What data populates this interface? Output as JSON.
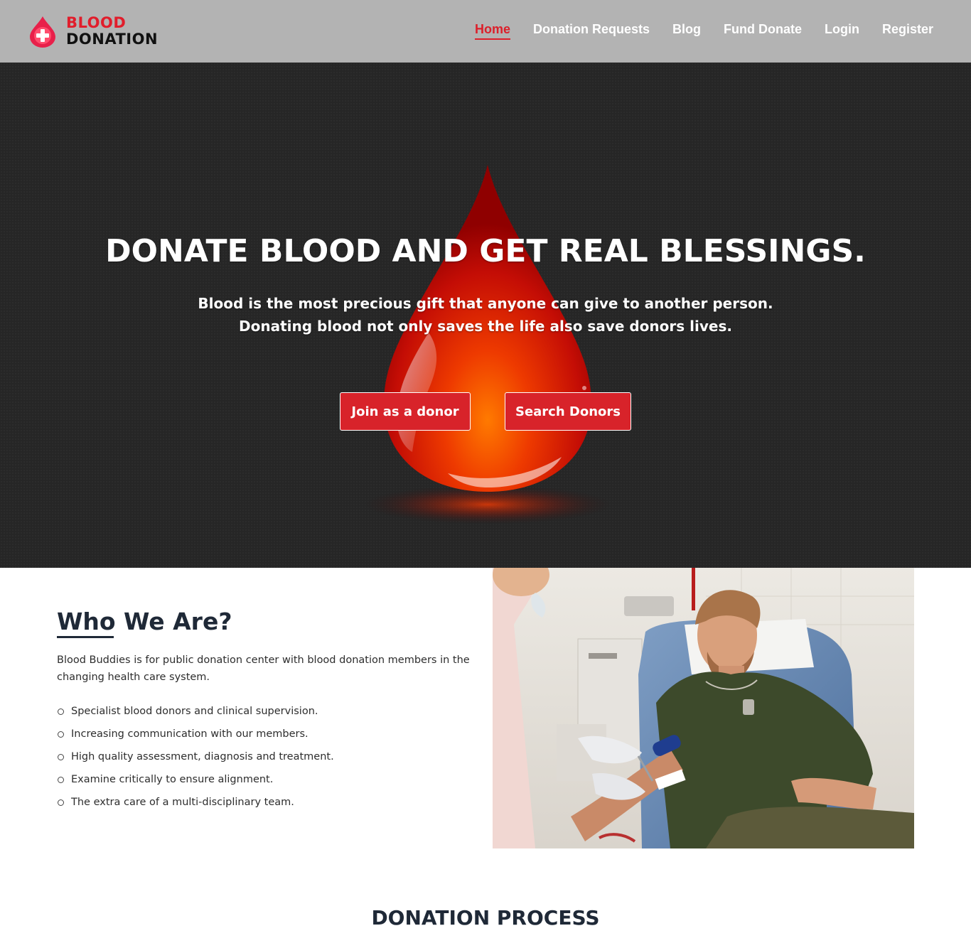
{
  "header": {
    "logo": {
      "line1": "BLOOD",
      "line2": "DONATION"
    },
    "nav": [
      {
        "label": "Home",
        "active": true
      },
      {
        "label": "Donation Requests"
      },
      {
        "label": "Blog"
      },
      {
        "label": "Fund Donate"
      },
      {
        "label": "Login"
      },
      {
        "label": "Register"
      }
    ]
  },
  "hero": {
    "title": "DONATE BLOOD AND GET REAL BLESSINGS.",
    "subtitle_line1": "Blood is the most precious gift that anyone can give to another person.",
    "subtitle_line2": "Donating blood not only saves the life also save donors lives.",
    "join_button": "Join as a donor",
    "search_button": "Search Donors"
  },
  "who": {
    "title": "Who We Are?",
    "description": "Blood Buddies is for public donation center with blood donation members in the changing health care system.",
    "items": [
      "Specialist blood donors and clinical supervision.",
      "Increasing communication with our members.",
      "High quality assessment, diagnosis and treatment.",
      "Examine critically to ensure alignment.",
      "The extra care of a multi-disciplinary team."
    ]
  },
  "process": {
    "title": "DONATION PROCESS"
  },
  "colors": {
    "brand_red": "#dc1f2a",
    "header_gray": "#b3b3b3",
    "hero_dark": "#262626"
  }
}
